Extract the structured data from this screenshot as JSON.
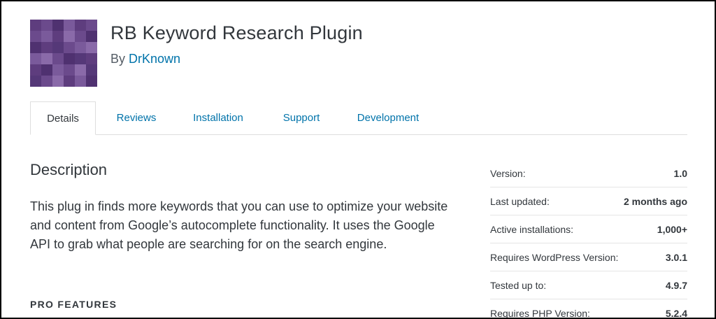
{
  "plugin": {
    "title": "RB Keyword Research Plugin",
    "by_prefix": "By",
    "author": "DrKnown",
    "icon_colors": [
      "#5e3d7e",
      "#6b4a8c",
      "#7a5a9b",
      "#4f3170",
      "#8a6aa9",
      "#553878"
    ]
  },
  "tabs": [
    {
      "label": "Details",
      "active": true
    },
    {
      "label": "Reviews",
      "active": false
    },
    {
      "label": "Installation",
      "active": false
    },
    {
      "label": "Support",
      "active": false
    },
    {
      "label": "Development",
      "active": false
    }
  ],
  "description": {
    "heading": "Description",
    "text": "This plug in finds more keywords that you can use to optimize your website and content from Google’s autocomplete functionality. It uses the Google API to grab what people are searching for on the search engine.",
    "pro_heading": "PRO FEATURES"
  },
  "meta": [
    {
      "label": "Version:",
      "value": "1.0"
    },
    {
      "label": "Last updated:",
      "value": "2 months ago"
    },
    {
      "label": "Active installations:",
      "value": "1,000+"
    },
    {
      "label": "Requires WordPress Version:",
      "value": "3.0.1"
    },
    {
      "label": "Tested up to:",
      "value": "4.9.7"
    },
    {
      "label": "Requires PHP Version:",
      "value": "5.2.4"
    }
  ],
  "colors": {
    "link": "#0073aa",
    "text": "#32373c",
    "muted": "#555d66",
    "border": "#dedede"
  }
}
